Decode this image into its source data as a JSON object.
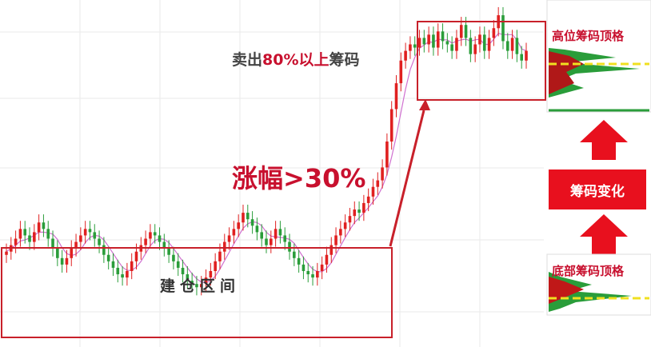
{
  "annotations": {
    "sell_prefix": "卖出",
    "sell_percent": "80%以上",
    "sell_suffix": "筹码",
    "rise": "涨幅>30%",
    "build": "建仓区间",
    "top_chip": "高位筹码顶格",
    "chip_change": "筹码变化",
    "bottom_chip": "底部筹码顶格"
  },
  "colors": {
    "up": "#e02020",
    "down": "#2a9d3a",
    "ma": "#d070d0",
    "box": "#c8202a",
    "arrow": "#e8101e",
    "dash": "#f0e020"
  },
  "chart_data": {
    "type": "candlestick",
    "ma_line": "true",
    "close": [
      26,
      28,
      30,
      33,
      31,
      29,
      32,
      35,
      33,
      30,
      27,
      24,
      22,
      24,
      27,
      29,
      31,
      33,
      32,
      30,
      28,
      25,
      23,
      21,
      19,
      18,
      20,
      23,
      26,
      28,
      30,
      32,
      31,
      29,
      27,
      25,
      23,
      21,
      19,
      17,
      16,
      15,
      16,
      18,
      20,
      23,
      26,
      29,
      31,
      33,
      35,
      38,
      36,
      34,
      32,
      30,
      28,
      30,
      33,
      31,
      29,
      26,
      24,
      22,
      20,
      19,
      18,
      20,
      22,
      25,
      28,
      31,
      33,
      35,
      37,
      39,
      38,
      41,
      43,
      46,
      48,
      52,
      60,
      70,
      78,
      85,
      88,
      90,
      89,
      92,
      90,
      93,
      89,
      94,
      91,
      90,
      88,
      92,
      96,
      92,
      87,
      90,
      93,
      88,
      92,
      95,
      99,
      91,
      88,
      92,
      87,
      85,
      88
    ]
  }
}
